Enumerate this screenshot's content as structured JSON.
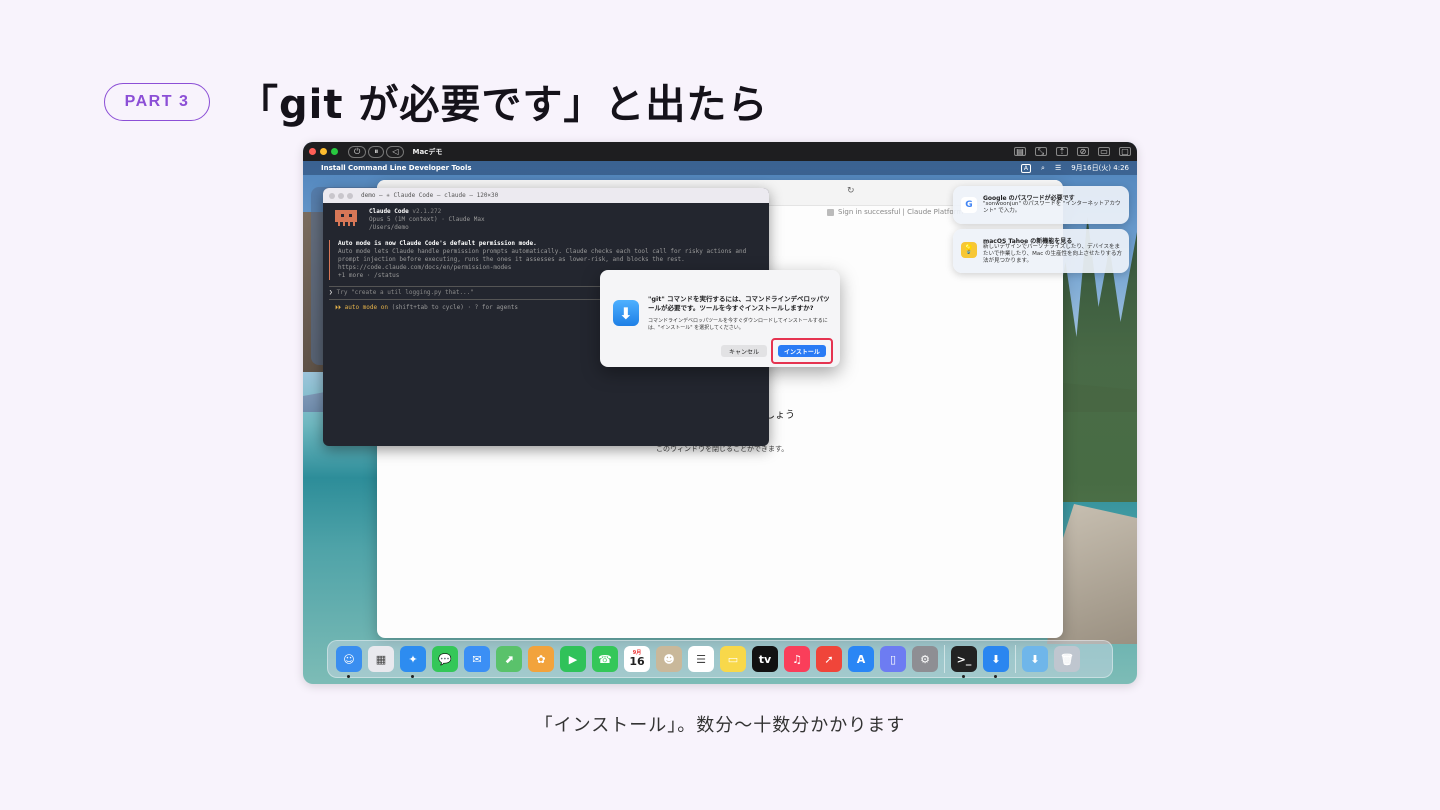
{
  "slide": {
    "part_label": "PART 3",
    "title": "「git が必要です」と出たら",
    "caption": "「インストール」。数分〜十数分かかります"
  },
  "vm_bar": {
    "title": "Macデモ",
    "controls": [
      "⏻",
      "⏸",
      "◁"
    ]
  },
  "menubar": {
    "apple": "",
    "app_name": "Install Command Line Developer Tools",
    "input_indicator": "A",
    "datetime": "9月16日(火) 4:26"
  },
  "browser": {
    "tab_hint": "Sign in successful | Claude Platform",
    "heading_partial": "しょう",
    "sub_partial": "・",
    "close_note": "このウィンドウを閉じることができます。"
  },
  "terminal": {
    "title": "demo — ✳ Claude Code — claude — 120×30",
    "app_name": "Claude Code",
    "version": "v2.1.272",
    "model_line": "Opus 5 (1M context) · Claude Max",
    "path": "/Users/demo",
    "notice_title": "Auto mode is now Claude Code's default permission mode.",
    "notice_lines": [
      "Auto mode lets Claude handle permission prompts automatically. Claude checks each tool call for risky actions and",
      "prompt injection before executing, runs the ones it assesses as lower-risk, and blocks the rest.",
      "https://code.claude.com/docs/en/permission-modes",
      "+1 more · /status"
    ],
    "prompt_placeholder": "Try \"create a util logging.py that...\"",
    "prompt_chevron": "❯",
    "automode_label": "⏵⏵ auto mode on",
    "automode_hint": "(shift+tab to cycle) · ? for agents"
  },
  "dialog": {
    "title": "\"git\" コマンドを実行するには、コマンドラインデベロッパツールが必要です。ツールを今すぐインストールしますか?",
    "body": "コマンドラインデベロッパツールを今すぐダウンロードしてインストールするには、\"インストール\" を選択してください。",
    "cancel_label": "キャンセル",
    "install_label": "インストール",
    "highlight_color": "#e53350"
  },
  "notifications": [
    {
      "icon": "G",
      "title": "Google のパスワードが必要です",
      "text": "\"sonwoonjun\" のパスワードを \"インターネットアカウント\" で入力。"
    },
    {
      "icon": "💡",
      "title": "macOS Tahoe の新機能を見る",
      "text": "新しいデザインでパーソナライズしたり、デバイスをまたいで作業したり、Mac の生産性を向上させたりする方法が見つかります。"
    }
  ],
  "dock": {
    "calendar_day": "16",
    "calendar_month": "9月",
    "apps": [
      {
        "name": "finder",
        "glyph": "☺",
        "color": "#3a8ef0",
        "running": true
      },
      {
        "name": "launchpad",
        "glyph": "▦",
        "color": "#e9e9ee",
        "running": false
      },
      {
        "name": "safari",
        "glyph": "✦",
        "color": "#2d8cf0",
        "running": true
      },
      {
        "name": "messages",
        "glyph": "💬",
        "color": "#34c759",
        "running": false
      },
      {
        "name": "mail",
        "glyph": "✉",
        "color": "#3b8ff5",
        "running": false
      },
      {
        "name": "maps",
        "glyph": "⬈",
        "color": "#5ac26b",
        "running": false
      },
      {
        "name": "photos",
        "glyph": "✿",
        "color": "#f2a33c",
        "running": false
      },
      {
        "name": "facetime",
        "glyph": "▶",
        "color": "#30c25a",
        "running": false
      },
      {
        "name": "phone",
        "glyph": "☎",
        "color": "#34c759",
        "running": false
      },
      {
        "name": "calendar",
        "glyph": "16",
        "color": "#ffffff",
        "running": false
      },
      {
        "name": "contacts",
        "glyph": "☻",
        "color": "#c9b89a",
        "running": false
      },
      {
        "name": "reminders",
        "glyph": "☰",
        "color": "#ffffff",
        "running": false
      },
      {
        "name": "notes",
        "glyph": "▭",
        "color": "#f8d84a",
        "running": false
      },
      {
        "name": "tv",
        "glyph": "tv",
        "color": "#111111",
        "running": false
      },
      {
        "name": "music",
        "glyph": "♫",
        "color": "#fa3e5a",
        "running": false
      },
      {
        "name": "rocket",
        "glyph": "➚",
        "color": "#f0453a",
        "running": false
      },
      {
        "name": "app-store",
        "glyph": "A",
        "color": "#2a86f5",
        "running": false
      },
      {
        "name": "iphone-mirroring",
        "glyph": "▯",
        "color": "#6d7cf2",
        "running": false
      },
      {
        "name": "system-settings",
        "glyph": "⚙",
        "color": "#8e8e93",
        "running": false
      }
    ],
    "running_apps": [
      {
        "name": "terminal",
        "glyph": ">_",
        "color": "#222222",
        "running": true
      },
      {
        "name": "installer",
        "glyph": "⬇",
        "color": "#2b86f0",
        "running": true
      }
    ],
    "trailing": [
      {
        "name": "downloads-folder",
        "glyph": "⬇",
        "color": "#6fb6ea",
        "running": false
      },
      {
        "name": "trash",
        "glyph": "🗑",
        "color": "#bfc6cf",
        "running": false
      }
    ]
  }
}
